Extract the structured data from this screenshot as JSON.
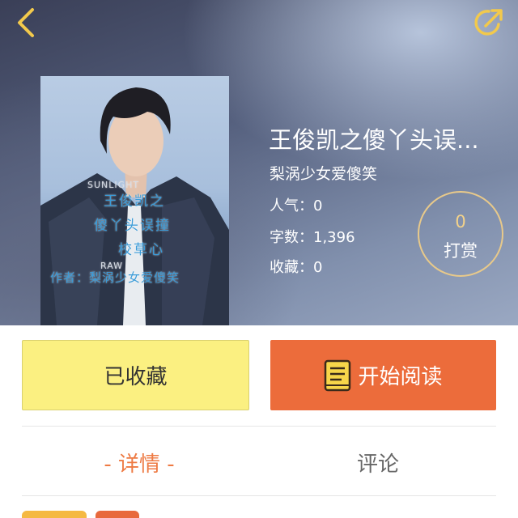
{
  "book": {
    "title": "王俊凯之傻丫头误...",
    "author": "梨涡少女爱傻笑",
    "popularity": "人气：0",
    "word_count": "字数：1,396",
    "favorites": "收藏：0"
  },
  "reward": {
    "count": "0",
    "label": "打赏"
  },
  "cover": {
    "line1": "王俊凯之",
    "line2": "傻丫头误撞",
    "line3": "校草心",
    "line4": "作者：梨涡少女爱傻笑",
    "jacket_text_1": "SUNLIGHT",
    "jacket_text_2": "RAW"
  },
  "actions": {
    "favorited_label": "已收藏",
    "read_label": "开始阅读"
  },
  "tabs": [
    {
      "label": "- 详情 -",
      "active": true
    },
    {
      "label": "评论",
      "active": false
    }
  ],
  "icons": {
    "back": "chevron-left-icon",
    "share": "share-icon",
    "read": "book-icon"
  },
  "colors": {
    "accent_yellow": "#f2c94c",
    "favorite_button": "#fbf081",
    "read_button": "#ec6c3b",
    "active_tab": "#ee7a43"
  }
}
